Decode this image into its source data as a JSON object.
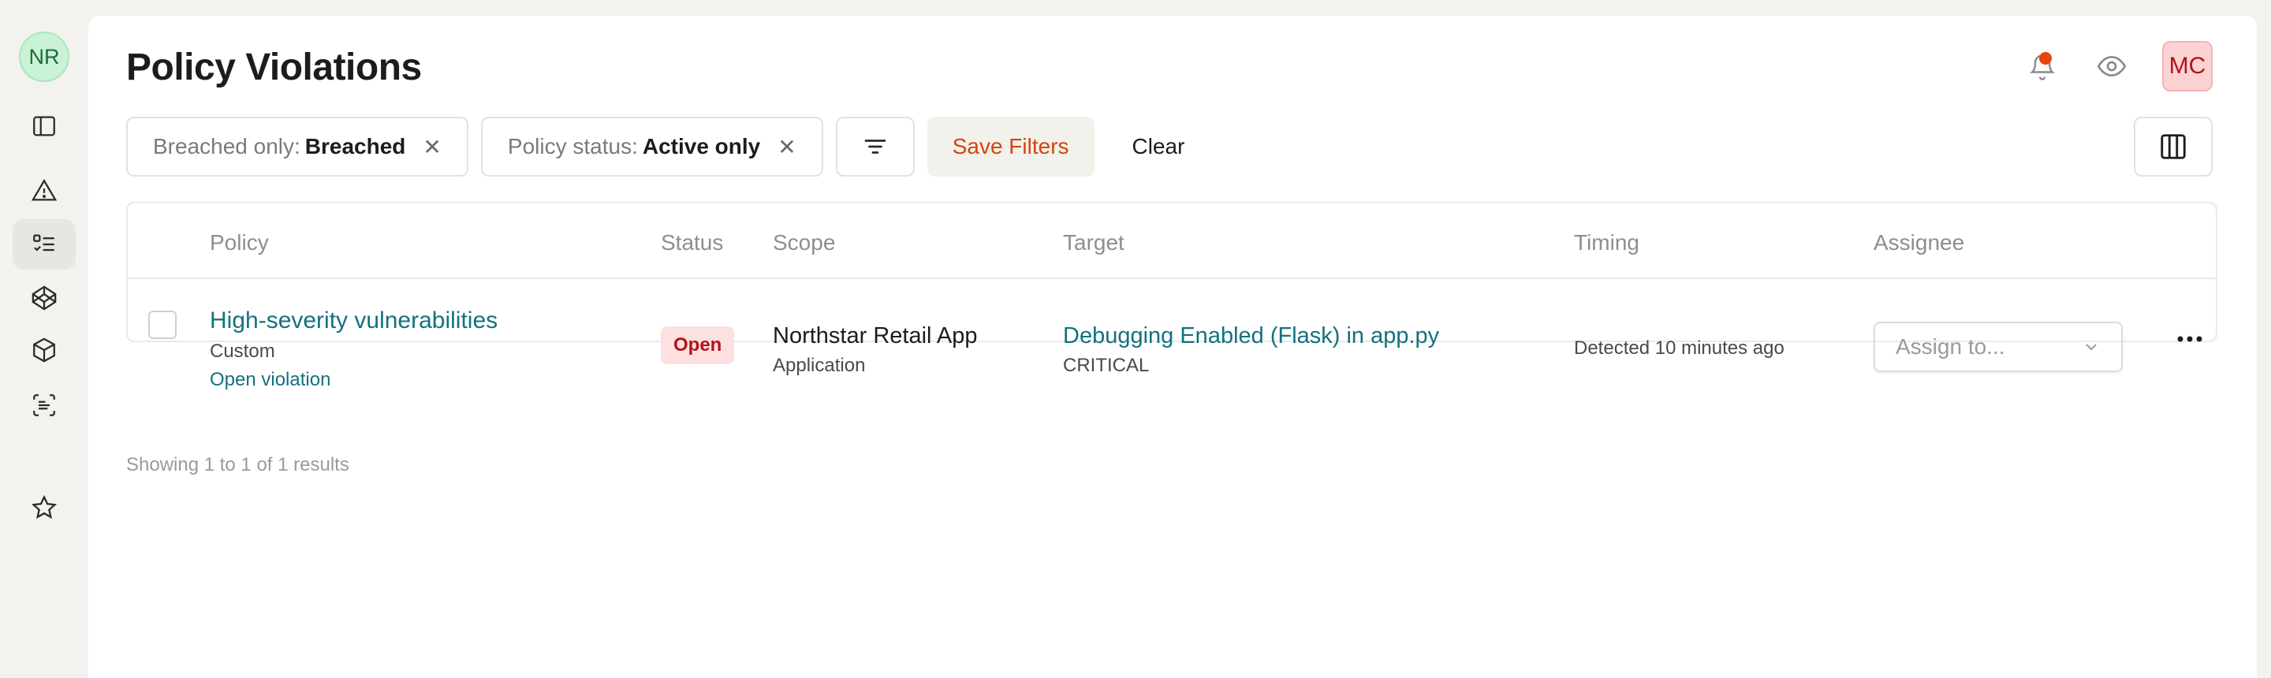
{
  "sidebar": {
    "workspace_initials": "NR",
    "items": [
      {
        "icon": "sidebar-toggle-icon"
      },
      {
        "icon": "alert-triangle-icon"
      },
      {
        "icon": "checklist-icon",
        "active": true
      },
      {
        "icon": "codepen-icon"
      },
      {
        "icon": "package-icon"
      },
      {
        "icon": "scan-text-icon"
      },
      {
        "icon": "star-icon"
      }
    ]
  },
  "header": {
    "title": "Policy Violations",
    "user_initials": "MC",
    "notification_dot_color": "#e8450f"
  },
  "filters": {
    "chips": [
      {
        "key": "Breached only:",
        "value": "Breached"
      },
      {
        "key": "Policy status:",
        "value": "Active only"
      }
    ],
    "remove_glyph": "✕",
    "save_label": "Save Filters",
    "clear_label": "Clear"
  },
  "table": {
    "columns": [
      "Policy",
      "Status",
      "Scope",
      "Target",
      "Timing",
      "Assignee"
    ],
    "rows": [
      {
        "policy_name": "High-severity vulnerabilities",
        "policy_type": "Custom",
        "policy_link": "Open violation",
        "status": "Open",
        "scope_name": "Northstar Retail App",
        "scope_type": "Application",
        "target_name": "Debugging Enabled (Flask) in app.py",
        "target_severity": "CRITICAL",
        "timing": "Detected 10 minutes ago",
        "assignee_placeholder": "Assign to..."
      }
    ]
  },
  "pagination": {
    "summary": "Showing 1 to 1 of 1 results"
  },
  "colors": {
    "accent_orange": "#d2450e",
    "link_teal": "#13727e",
    "status_open_bg": "#fde0e0",
    "status_open_text": "#b3121c"
  }
}
